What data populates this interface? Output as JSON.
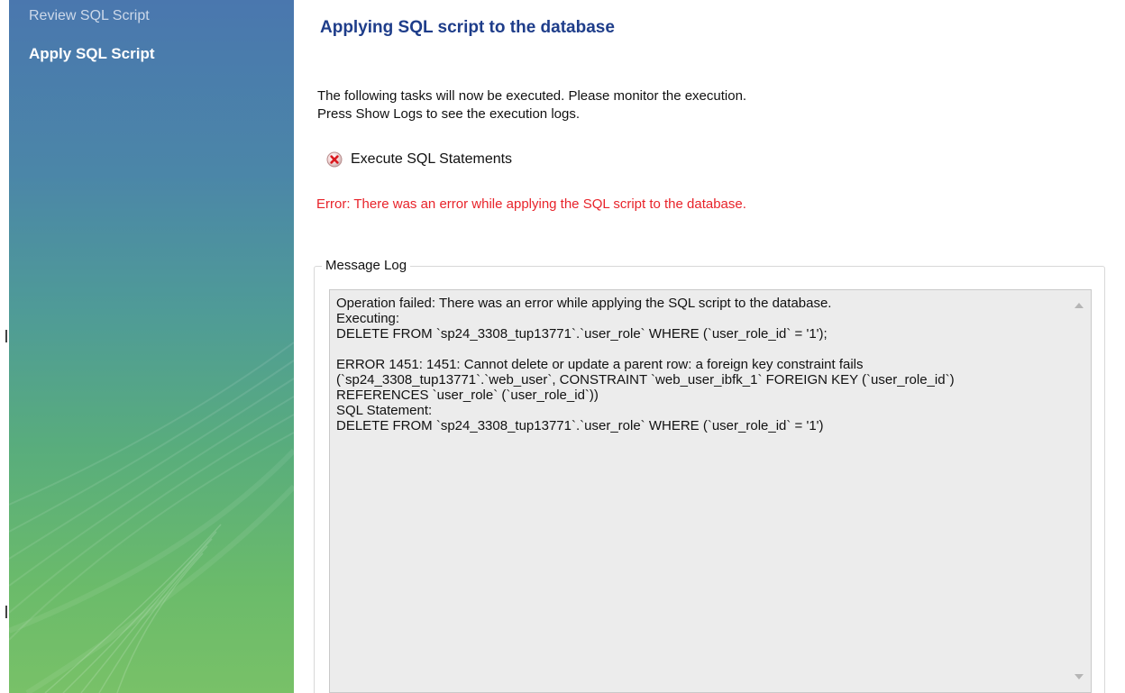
{
  "sidebar": {
    "items": [
      {
        "label": "Review SQL Script",
        "active": false
      },
      {
        "label": "Apply SQL Script",
        "active": true
      }
    ]
  },
  "main": {
    "title": "Applying SQL script to the database",
    "instructions": [
      "The following tasks will now be executed. Please monitor the execution.",
      "Press Show Logs to see the execution logs."
    ],
    "task": {
      "label": "Execute SQL Statements",
      "status_icon": "error-circle-x-icon"
    },
    "error_message": "Error: There was an error while applying the SQL script to the database.",
    "message_log": {
      "title": "Message Log",
      "lines": [
        "Operation failed: There was an error while applying the SQL script to the database.",
        "Executing:",
        "DELETE FROM `sp24_3308_tup13771`.`user_role` WHERE (`user_role_id` = '1');",
        "",
        "ERROR 1451: 1451: Cannot delete or update a parent row: a foreign key constraint fails",
        "(`sp24_3308_tup13771`.`web_user`, CONSTRAINT `web_user_ibfk_1` FOREIGN KEY (`user_role_id`)",
        "REFERENCES `user_role` (`user_role_id`))",
        "SQL Statement:",
        "DELETE FROM `sp24_3308_tup13771`.`user_role` WHERE (`user_role_id` = '1')"
      ]
    }
  },
  "colors": {
    "title": "#1e3d8a",
    "error": "#e8232a",
    "log_background": "#ececec"
  }
}
